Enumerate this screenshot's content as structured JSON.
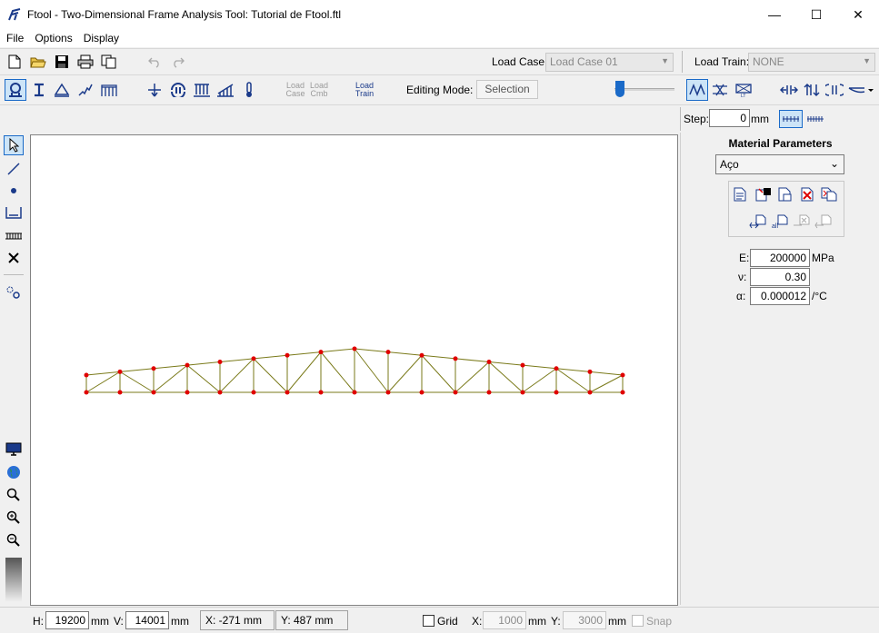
{
  "window": {
    "title": "Ftool - Two-Dimensional Frame Analysis Tool: Tutorial de Ftool.ftl",
    "minimize": "—",
    "maximize": "☐",
    "close": "✕"
  },
  "menu": [
    "File",
    "Options",
    "Display"
  ],
  "toolbar1": {
    "load_case_label": "Load Case:",
    "load_case_value": "Load Case 01",
    "load_train_label": "Load Train:",
    "load_train_value": "NONE"
  },
  "toolbar2": {
    "load_case_btn": [
      "Load",
      "Case"
    ],
    "load_cmb_btn": [
      "Load",
      "Cmb"
    ],
    "load_train_btn": [
      "Load",
      "Train"
    ],
    "editing_mode_label": "Editing Mode:",
    "editing_mode_value": "Selection"
  },
  "toolbar3": {
    "step_label": "Step:",
    "step_value": "0",
    "step_unit": "mm"
  },
  "material": {
    "title": "Material Parameters",
    "selected": "Aço",
    "E_label": "E:",
    "E_value": "200000",
    "E_unit": "MPa",
    "nu_label": "ν:",
    "nu_value": "0.30",
    "alpha_label": "α:",
    "alpha_value": "0.000012",
    "alpha_unit": "/°C"
  },
  "status": {
    "h_label": "H:",
    "h_value": "19200",
    "h_unit": "mm",
    "v_label": "V:",
    "v_value": "14001",
    "v_unit": "mm",
    "cursor_x": "X: -271 mm",
    "cursor_y": "Y: 487 mm",
    "grid_label": "Grid",
    "grid_x_label": "X:",
    "grid_x_value": "1000",
    "grid_x_unit": "mm",
    "grid_y_label": "Y:",
    "grid_y_value": "3000",
    "grid_y_unit": "mm",
    "snap_label": "Snap"
  },
  "colors": {
    "member": "#7a7a1a",
    "node": "#e00000",
    "accent": "#1a3a8a",
    "toggle_bg": "#cce4f7"
  },
  "truss": {
    "bottom_chord_y": 0,
    "note_units": "relative"
  }
}
